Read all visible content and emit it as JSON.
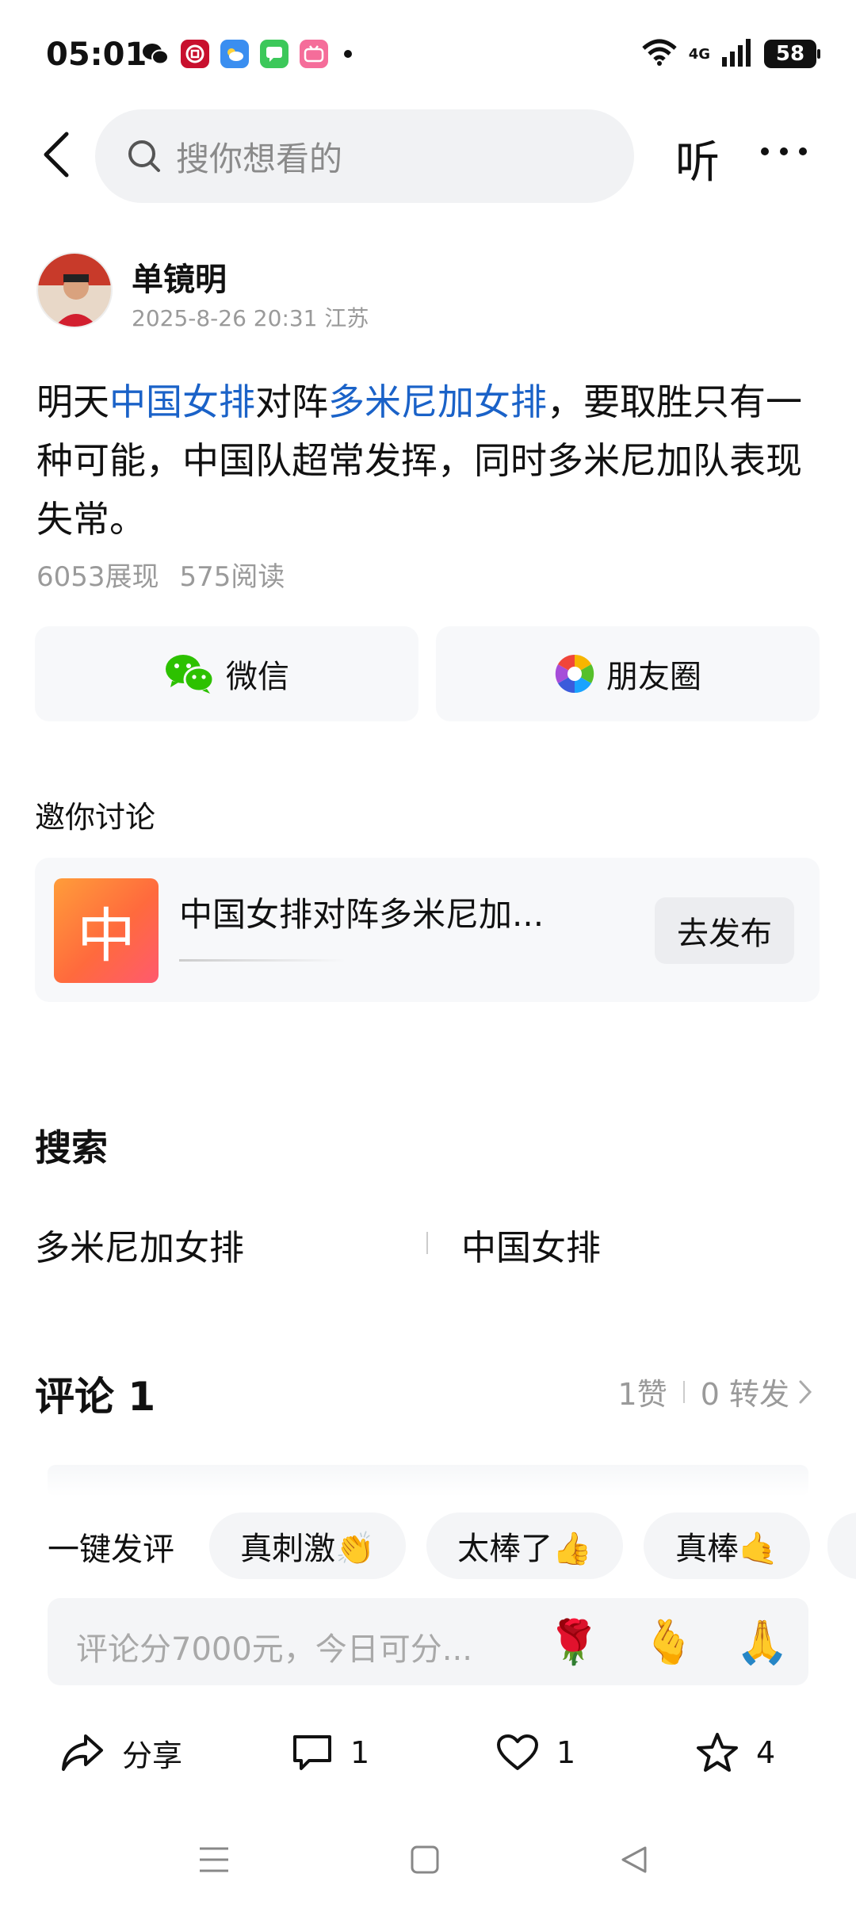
{
  "status_bar": {
    "time": "05:01",
    "notification_icons": [
      "wechat-icon",
      "bank-app-icon",
      "weather-icon",
      "message-icon",
      "bilibili-icon"
    ],
    "network": "4G",
    "battery": "58"
  },
  "header": {
    "search_placeholder": "搜你想看的",
    "listen_label": "听"
  },
  "author": {
    "name": "单镜明",
    "meta": "2025-8-26 20:31 江苏"
  },
  "post": {
    "segments": [
      {
        "text": "明天",
        "tag": false
      },
      {
        "text": "中国女排",
        "tag": true
      },
      {
        "text": "对阵",
        "tag": false
      },
      {
        "text": "多米尼加女排",
        "tag": true
      },
      {
        "text": "，要取胜只有一种可能，中国队超常发挥，同时多米尼加队表现失常。",
        "tag": false
      }
    ],
    "impressions": "6053展现",
    "reads": "575阅读",
    "tag_color": "#1a62c8"
  },
  "share": {
    "wechat_label": "微信",
    "moments_label": "朋友圈"
  },
  "invite": {
    "title": "邀你讨论",
    "thumb_char": "中",
    "topic": "中国女排对阵多米尼加...",
    "publish_label": "去发布"
  },
  "search_section": {
    "title": "搜索",
    "terms": [
      "多米尼加女排",
      "中国女排"
    ]
  },
  "comments": {
    "title": "评论 1",
    "likes": "1赞",
    "reposts": "0 转发",
    "quick_label": "一键发评",
    "quick_chips": [
      "真刺激👏",
      "太棒了👍",
      "真棒🤙"
    ],
    "input_placeholder": "评论分7000元，今日可分...",
    "emojis": [
      "🌹",
      "🫰",
      "🙏"
    ]
  },
  "actions": {
    "share_label": "分享",
    "comment_count": "1",
    "like_count": "1",
    "favorite_count": "4"
  },
  "colors": {
    "accent_link": "#1a62c8",
    "muted_text": "#9a9a9a",
    "card_bg": "#f7f8fa"
  }
}
